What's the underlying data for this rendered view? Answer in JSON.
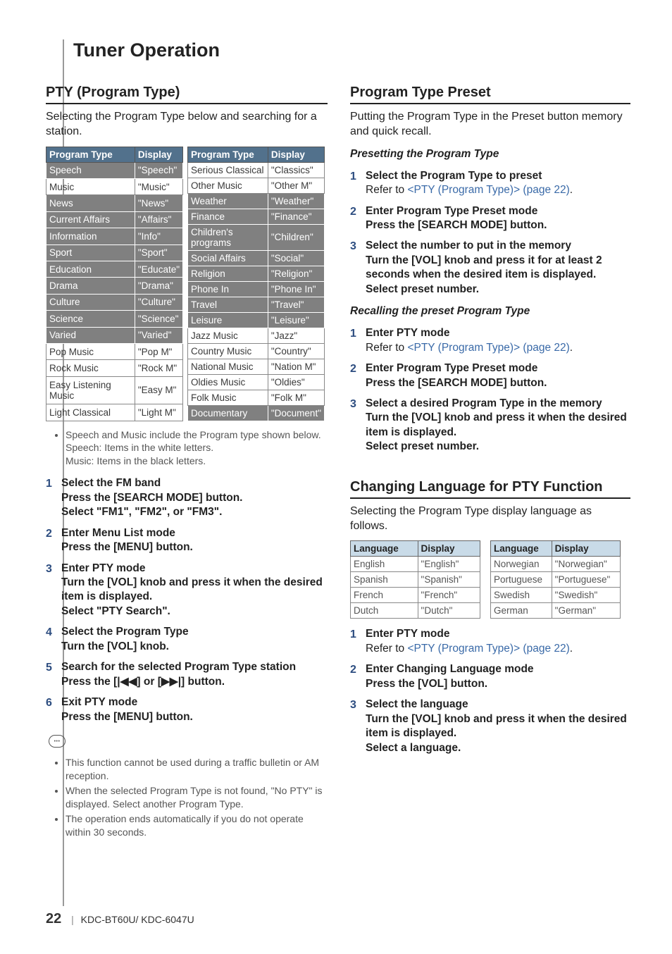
{
  "title": "Tuner Operation",
  "footer": {
    "page": "22",
    "model": "KDC-BT60U/ KDC-6047U"
  },
  "left": {
    "heading": "PTY (Program Type)",
    "intro": "Selecting the Program Type below and searching for a station.",
    "tableA": {
      "col1": "Program Type",
      "col2": "Display",
      "rows": [
        {
          "t": "Speech",
          "d": "\"Speech\"",
          "dark": true
        },
        {
          "t": "Music",
          "d": "\"Music\"",
          "dark": false
        },
        {
          "t": "News",
          "d": "\"News\"",
          "dark": true
        },
        {
          "t": "Current Affairs",
          "d": "\"Affairs\"",
          "dark": true
        },
        {
          "t": "Information",
          "d": "\"Info\"",
          "dark": true
        },
        {
          "t": "Sport",
          "d": "\"Sport\"",
          "dark": true
        },
        {
          "t": "Education",
          "d": "\"Educate\"",
          "dark": true
        },
        {
          "t": "Drama",
          "d": "\"Drama\"",
          "dark": true
        },
        {
          "t": "Culture",
          "d": "\"Culture\"",
          "dark": true
        },
        {
          "t": "Science",
          "d": "\"Science\"",
          "dark": true
        },
        {
          "t": "Varied",
          "d": "\"Varied\"",
          "dark": true
        },
        {
          "t": "Pop Music",
          "d": "\"Pop M\"",
          "dark": false
        },
        {
          "t": "Rock Music",
          "d": "\"Rock M\"",
          "dark": false
        },
        {
          "t": "Easy Listening Music",
          "d": "\"Easy M\"",
          "dark": false
        },
        {
          "t": "Light Classical",
          "d": "\"Light M\"",
          "dark": false
        }
      ]
    },
    "tableB": {
      "col1": "Program Type",
      "col2": "Display",
      "rows": [
        {
          "t": "Serious Classical",
          "d": "\"Classics\"",
          "dark": false
        },
        {
          "t": "Other Music",
          "d": "\"Other M\"",
          "dark": false
        },
        {
          "t": "Weather",
          "d": "\"Weather\"",
          "dark": true
        },
        {
          "t": "Finance",
          "d": "\"Finance\"",
          "dark": true
        },
        {
          "t": "Children's programs",
          "d": "\"Children\"",
          "dark": true
        },
        {
          "t": "Social Affairs",
          "d": "\"Social\"",
          "dark": true
        },
        {
          "t": "Religion",
          "d": "\"Religion\"",
          "dark": true
        },
        {
          "t": "Phone In",
          "d": "\"Phone In\"",
          "dark": true
        },
        {
          "t": "Travel",
          "d": "\"Travel\"",
          "dark": true
        },
        {
          "t": "Leisure",
          "d": "\"Leisure\"",
          "dark": true
        },
        {
          "t": "Jazz Music",
          "d": "\"Jazz\"",
          "dark": false
        },
        {
          "t": "Country Music",
          "d": "\"Country\"",
          "dark": false
        },
        {
          "t": "National Music",
          "d": "\"Nation M\"",
          "dark": false
        },
        {
          "t": "Oldies Music",
          "d": "\"Oldies\"",
          "dark": false
        },
        {
          "t": "Folk Music",
          "d": "\"Folk M\"",
          "dark": false
        },
        {
          "t": "Documentary",
          "d": "\"Document\"",
          "dark": true
        }
      ]
    },
    "note1": [
      "Speech and Music include the Program type shown below.",
      "Speech: Items in the white letters.",
      "Music: Items in the black letters."
    ],
    "steps": [
      {
        "n": "1",
        "title": "Select the FM band",
        "body": [
          "Press the [SEARCH MODE] button.",
          "Select \"FM1\", \"FM2\", or \"FM3\"."
        ]
      },
      {
        "n": "2",
        "title": "Enter Menu List mode",
        "body": [
          "Press the [MENU] button."
        ]
      },
      {
        "n": "3",
        "title": "Enter PTY mode",
        "body": [
          "Turn the [VOL] knob and press it when the desired item is displayed.",
          "Select \"PTY Search\"."
        ]
      },
      {
        "n": "4",
        "title": "Select the Program Type",
        "body": [
          "Turn the [VOL] knob."
        ]
      },
      {
        "n": "5",
        "title": "Search for the selected Program Type station",
        "body": [
          "Press the [|◀◀] or [▶▶|] button."
        ]
      },
      {
        "n": "6",
        "title": "Exit PTY mode",
        "body": [
          "Press the [MENU] button."
        ]
      }
    ],
    "note2": [
      "This function cannot be used during a traffic bulletin or AM reception.",
      "When the selected Program Type is not found, \"No PTY\" is displayed. Select another Program Type.",
      "The operation ends automatically if you do not operate within 30 seconds."
    ]
  },
  "right": {
    "heading1": "Program Type Preset",
    "intro1": "Putting the Program Type in the Preset button memory and quick recall.",
    "sub1": "Presetting the Program Type",
    "stepsA": [
      {
        "n": "1",
        "title": "Select the Program Type to preset",
        "plain": "Refer to ",
        "link": "<PTY (Program Type)> (page 22)",
        "tail": "."
      },
      {
        "n": "2",
        "title": "Enter Program Type Preset mode",
        "body": [
          "Press the [SEARCH MODE] button."
        ]
      },
      {
        "n": "3",
        "title": "Select the number to put in the memory",
        "body": [
          "Turn the [VOL] knob and press it for at least 2 seconds when the desired item is displayed.",
          "Select preset number."
        ]
      }
    ],
    "sub2": "Recalling the preset Program Type",
    "stepsB": [
      {
        "n": "1",
        "title": "Enter PTY mode",
        "plain": "Refer to ",
        "link": "<PTY (Program Type)> (page 22)",
        "tail": "."
      },
      {
        "n": "2",
        "title": "Enter Program Type Preset mode",
        "body": [
          "Press the [SEARCH MODE] button."
        ]
      },
      {
        "n": "3",
        "title": "Select a desired Program Type in the memory",
        "body": [
          "Turn the [VOL] knob and press it when the desired item is displayed.",
          "Select preset number."
        ]
      }
    ],
    "heading2": "Changing Language for PTY Function",
    "intro2": "Selecting the Program Type display language as follows.",
    "langA": {
      "col1": "Language",
      "col2": "Display",
      "rows": [
        {
          "t": "English",
          "d": "\"English\""
        },
        {
          "t": "Spanish",
          "d": "\"Spanish\""
        },
        {
          "t": "French",
          "d": "\"French\""
        },
        {
          "t": "Dutch",
          "d": "\"Dutch\""
        }
      ]
    },
    "langB": {
      "col1": "Language",
      "col2": "Display",
      "rows": [
        {
          "t": "Norwegian",
          "d": "\"Norwegian\""
        },
        {
          "t": "Portuguese",
          "d": "\"Portuguese\""
        },
        {
          "t": "Swedish",
          "d": "\"Swedish\""
        },
        {
          "t": "German",
          "d": "\"German\""
        }
      ]
    },
    "stepsC": [
      {
        "n": "1",
        "title": "Enter PTY mode",
        "plain": "Refer to ",
        "link": "<PTY (Program Type)> (page 22)",
        "tail": "."
      },
      {
        "n": "2",
        "title": "Enter Changing Language mode",
        "body": [
          "Press the [VOL] button."
        ]
      },
      {
        "n": "3",
        "title": "Select the language",
        "body": [
          "Turn the [VOL] knob and press it when the desired item is displayed.",
          "Select a language."
        ]
      }
    ]
  }
}
